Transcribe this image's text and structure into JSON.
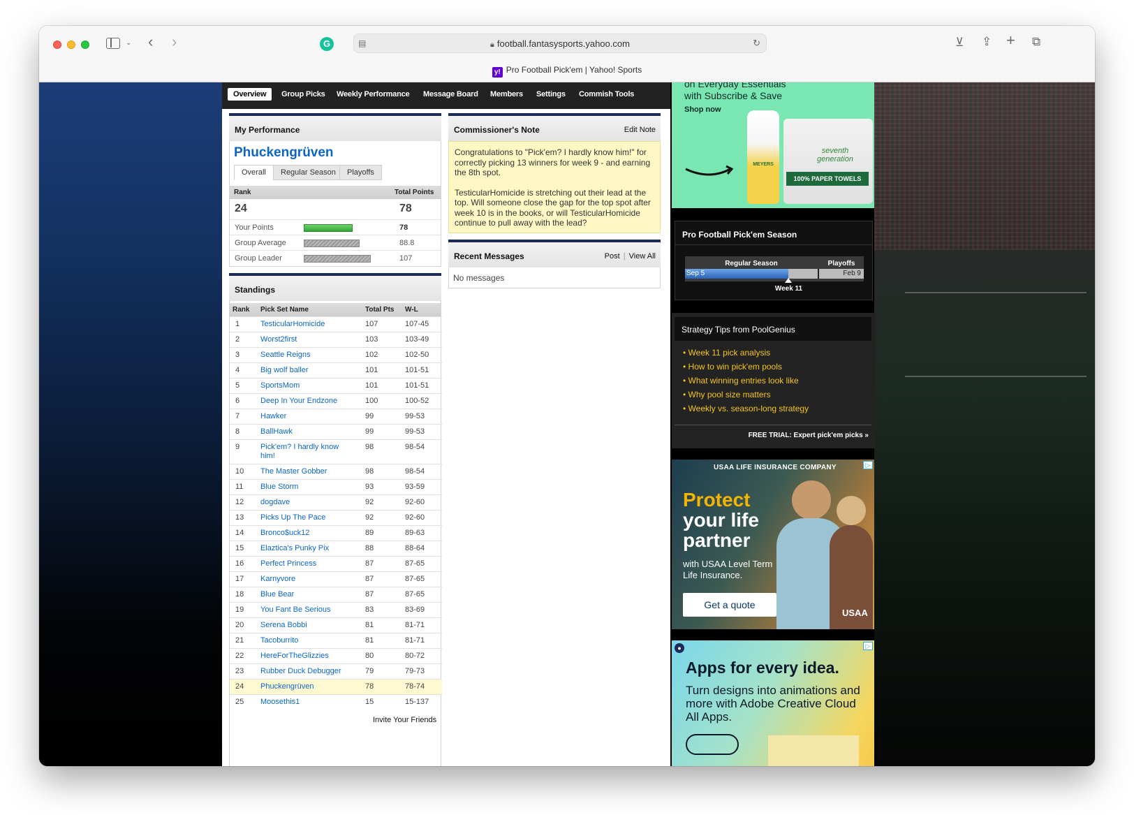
{
  "browser": {
    "url": "football.fantasysports.yahoo.com",
    "tab_title": "Pro Football Pick'em | Yahoo! Sports",
    "favicon_letter": "y!",
    "grammarly_letter": "G"
  },
  "nav": {
    "items": [
      "Overview",
      "Group Picks",
      "Weekly Performance",
      "Message Board",
      "Members",
      "Settings",
      "Commish Tools"
    ],
    "active": "Overview"
  },
  "my_performance": {
    "title": "My Performance",
    "team_name": "Phuckengrüven",
    "tabs": [
      "Overall",
      "Regular Season",
      "Playoffs"
    ],
    "rank_label": "Rank",
    "total_points_label": "Total Points",
    "rank": "24",
    "total_points": "78",
    "rows": [
      {
        "label": "Your Points",
        "value": "78",
        "fraction": 0.729
      },
      {
        "label": "Group Average",
        "value": "88.8",
        "fraction": 0.83
      },
      {
        "label": "Group Leader",
        "value": "107",
        "fraction": 1.0
      }
    ]
  },
  "standings": {
    "title": "Standings",
    "headers": {
      "rank": "Rank",
      "name": "Pick Set Name",
      "pts": "Total Pts",
      "wl": "W-L"
    },
    "rows": [
      {
        "rank": "1",
        "name": "TesticularHomicide",
        "pts": "107",
        "wl": "107-45"
      },
      {
        "rank": "2",
        "name": "Worst2first",
        "pts": "103",
        "wl": "103-49"
      },
      {
        "rank": "3",
        "name": "Seattle Reigns",
        "pts": "102",
        "wl": "102-50"
      },
      {
        "rank": "4",
        "name": "Big wolf baller",
        "pts": "101",
        "wl": "101-51"
      },
      {
        "rank": "5",
        "name": "SportsMom",
        "pts": "101",
        "wl": "101-51"
      },
      {
        "rank": "6",
        "name": "Deep In Your Endzone",
        "pts": "100",
        "wl": "100-52"
      },
      {
        "rank": "7",
        "name": "Hawker",
        "pts": "99",
        "wl": "99-53"
      },
      {
        "rank": "8",
        "name": "BallHawk",
        "pts": "99",
        "wl": "99-53"
      },
      {
        "rank": "9",
        "name": "Pick'em? I hardly know him!",
        "pts": "98",
        "wl": "98-54"
      },
      {
        "rank": "10",
        "name": "The Master Gobber",
        "pts": "98",
        "wl": "98-54"
      },
      {
        "rank": "11",
        "name": "Blue Storm",
        "pts": "93",
        "wl": "93-59"
      },
      {
        "rank": "12",
        "name": "dogdave",
        "pts": "92",
        "wl": "92-60"
      },
      {
        "rank": "13",
        "name": "Picks Up The Pace",
        "pts": "92",
        "wl": "92-60"
      },
      {
        "rank": "14",
        "name": "Bronco$uck12",
        "pts": "89",
        "wl": "89-63"
      },
      {
        "rank": "15",
        "name": "Elaztica's Punky Pix",
        "pts": "88",
        "wl": "88-64"
      },
      {
        "rank": "16",
        "name": "Perfect Princess",
        "pts": "87",
        "wl": "87-65"
      },
      {
        "rank": "17",
        "name": "Karnyvore",
        "pts": "87",
        "wl": "87-65"
      },
      {
        "rank": "18",
        "name": "Blue Bear",
        "pts": "87",
        "wl": "87-65"
      },
      {
        "rank": "19",
        "name": "You Fant Be Serious",
        "pts": "83",
        "wl": "83-69"
      },
      {
        "rank": "20",
        "name": "Serena Bobbi",
        "pts": "81",
        "wl": "81-71"
      },
      {
        "rank": "21",
        "name": "Tacoburrito",
        "pts": "81",
        "wl": "81-71"
      },
      {
        "rank": "22",
        "name": "HereForTheGlizzies",
        "pts": "80",
        "wl": "80-72"
      },
      {
        "rank": "23",
        "name": "Rubber Duck Debugger",
        "pts": "79",
        "wl": "79-73"
      },
      {
        "rank": "24",
        "name": "Phuckengrüven",
        "pts": "78",
        "wl": "78-74"
      },
      {
        "rank": "25",
        "name": "Moosethis1",
        "pts": "15",
        "wl": "15-137"
      }
    ],
    "highlight_rank": "24",
    "invite_link": "Invite Your Friends"
  },
  "commissioner_note": {
    "title": "Commissioner's Note",
    "edit_link": "Edit Note",
    "paragraphs": [
      "Congratulations to \"Pick'em? I hardly know him!\" for correctly picking 13 winners for week 9 - and earning the 8th spot.",
      "TesticularHomicide is stretching out their lead at the top. Will someone close the gap for the top spot after week 10 is in the books, or will TesticularHomicide continue to pull away with the lead?"
    ]
  },
  "recent_messages": {
    "title": "Recent Messages",
    "post_link": "Post",
    "separator": "|",
    "view_all_link": "View All",
    "empty_text": "No messages"
  },
  "ad_amazon": {
    "line1": "on Everyday Essentials",
    "line2": "with Subscribe & Save",
    "cta": "Shop now",
    "product1_label": "MEYERS",
    "product2_brand": "seventh generation",
    "product2_label": "100% PAPER TOWELS"
  },
  "season": {
    "title": "Pro Football Pick'em Season",
    "regular_label": "Regular Season",
    "playoffs_label": "Playoffs",
    "start_label": "Sep 5",
    "end_label": "Feb 9",
    "current_week": "Week 11",
    "progress_fraction": 0.58
  },
  "tips": {
    "title": "Strategy Tips from PoolGenius",
    "links": [
      "Week 11 pick analysis",
      "How to win pick'em pools",
      "What winning entries look like",
      "Why pool size matters",
      "Weekly vs. season-long strategy"
    ],
    "trial_link": "FREE TRIAL: Expert pick'em picks »"
  },
  "ad_usaa": {
    "company": "USAA LIFE INSURANCE COMPANY",
    "headline1": "Protect",
    "headline2": "your life",
    "headline3": "partner",
    "subtext": "with USAA Level Term Life Insurance.",
    "cta": "Get a quote",
    "brand": "USAA"
  },
  "ad_adobe": {
    "headline": "Apps for every idea.",
    "subtext": "Turn designs into animations and more with Adobe Creative Cloud All Apps."
  },
  "colors": {
    "link_blue": "#0c66c8",
    "nav_bg": "#222222",
    "panel_accent": "#1b2b5b",
    "note_bg": "#fff7c4",
    "tips_link": "#f5c518",
    "usaa_yellow": "#f5b400"
  }
}
